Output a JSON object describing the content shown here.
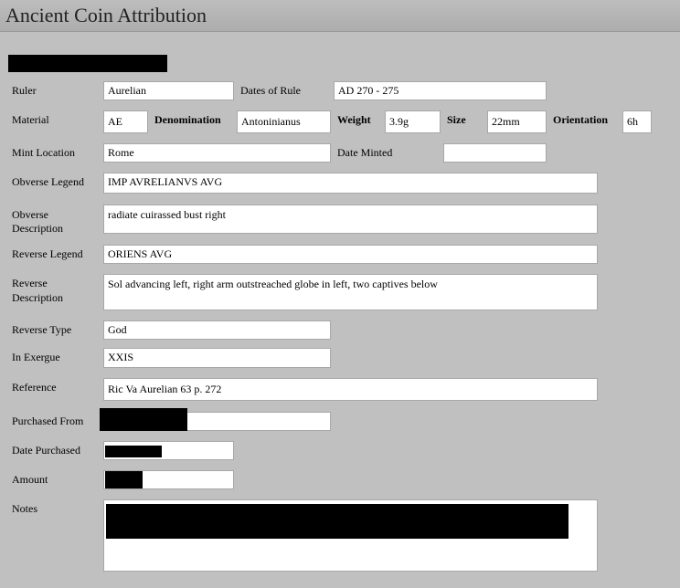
{
  "window": {
    "title": "Ancient Coin Attribution"
  },
  "labels": {
    "ruler": "Ruler",
    "dates_of_rule": "Dates of Rule",
    "material": "Material",
    "denomination": "Denomination",
    "weight": "Weight",
    "size": "Size",
    "orientation": "Orientation",
    "mint_location": "Mint Location",
    "date_minted": "Date Minted",
    "obverse_legend": "Obverse Legend",
    "obverse_description_1": "Obverse",
    "obverse_description_2": "Description",
    "reverse_legend": "Reverse Legend",
    "reverse_description_1": "Reverse",
    "reverse_description_2": "Description",
    "reverse_type": "Reverse Type",
    "in_exergue": "In Exergue",
    "reference": "Reference",
    "purchased_from": "Purchased From",
    "date_purchased": "Date Purchased",
    "amount": "Amount",
    "notes": "Notes"
  },
  "values": {
    "ruler": "Aurelian",
    "dates_of_rule": "AD 270 - 275",
    "material": "AE",
    "denomination": "Antoninianus",
    "weight": "3.9g",
    "size": "22mm",
    "orientation": "6h",
    "mint_location": "Rome",
    "date_minted": "",
    "obverse_legend": "IMP AVRELIANVS AVG",
    "obverse_description": "radiate cuirassed bust right",
    "reverse_legend": "ORIENS AVG",
    "reverse_description": "Sol advancing left, right arm outstreached globe in left, two captives below",
    "reverse_type": "God",
    "in_exergue": "XXIS",
    "reference": "Ric Va Aurelian 63 p. 272",
    "purchased_from": "",
    "date_purchased": "",
    "amount": "",
    "notes": ""
  }
}
